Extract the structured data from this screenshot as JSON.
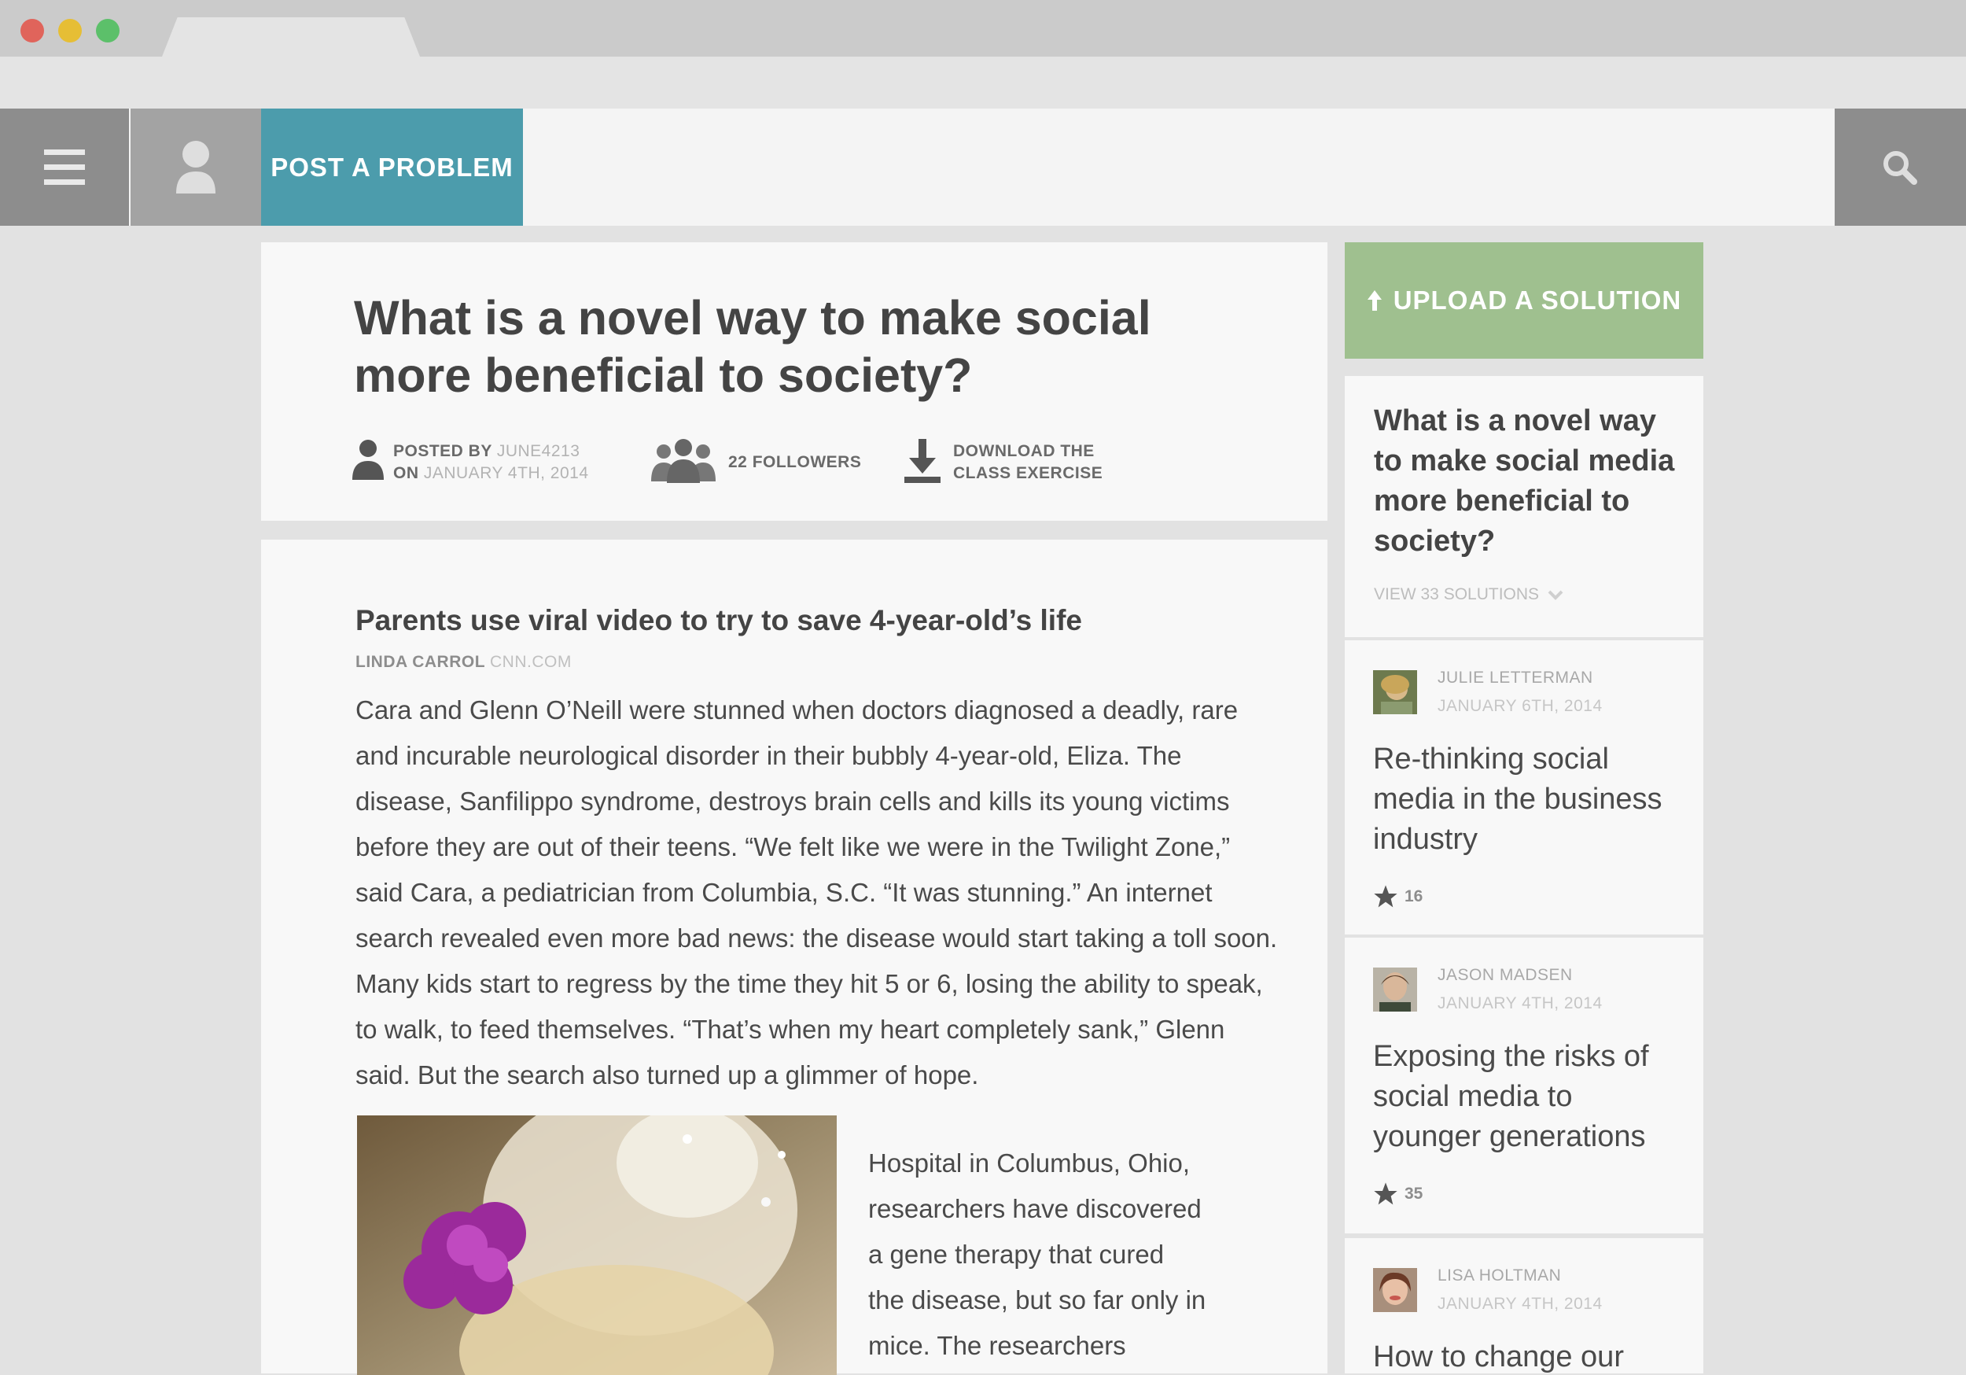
{
  "browser": {
    "window_controls": [
      "close",
      "minimize",
      "zoom"
    ],
    "tab_title": ""
  },
  "nav": {
    "menu_icon": "hamburger-menu-icon",
    "user_icon": "user-icon",
    "post_label": "POST A PROBLEM",
    "search_icon": "search-icon",
    "post_color": "#4c9cac"
  },
  "question": {
    "title": "What is a novel way to make social more beneficial to society?",
    "posted_by_label": "POSTED BY",
    "posted_by_user": "JUNE4213",
    "on_label": "ON",
    "date": "JANUARY 4TH, 2014",
    "followers": "22 FOLLOWERS",
    "download_line1": "DOWNLOAD THE",
    "download_line2": "CLASS EXERCISE"
  },
  "article": {
    "title": "Parents use viral video to try to save 4-year-old’s life",
    "author": "LINDA CARROL",
    "source": "CNN.COM",
    "body": "Cara and Glenn O’Neill were stunned when doctors diagnosed a deadly, rare and incurable neurological disorder in their bubbly 4-year-old, Eliza. The disease, Sanfilippo syndrome, destroys brain cells and kills its young victims before they are out of their teens. “We felt like we were in the Twilight Zone,” said Cara, a pediatrician from Columbia, S.C. “It was stunning.” An internet search revealed even more bad news: the disease would start taking a toll soon. Many kids start to regress by the time they hit 5 or 6, losing the ability to speak, to walk, to feed themselves. “That’s when my heart completely sank,” Glenn said. But the search also turned up a glimmer of hope.",
    "side_text": "Hospital in Columbus, Ohio, researchers have discovered a gene therapy that cured the disease, but so far only in mice. The researchers"
  },
  "sidebar": {
    "upload_label": "UPLOAD A SOLUTION",
    "upload_color": "#9fc08f",
    "question_title": "What is a novel way to make social media more beneficial to society?",
    "view_solutions": "VIEW 33 SOLUTIONS",
    "solutions": [
      {
        "author": "JULIE LETTERMAN",
        "date": "JANUARY 6TH, 2014",
        "title": "Re-thinking social media in the business industry",
        "stars": "16"
      },
      {
        "author": "JASON MADSEN",
        "date": "JANUARY 4TH, 2014",
        "title": "Exposing the risks of social media to younger generations",
        "stars": "35"
      },
      {
        "author": "LISA HOLTMAN",
        "date": "JANUARY 4TH, 2014",
        "title": "How to change our",
        "stars": ""
      }
    ]
  }
}
